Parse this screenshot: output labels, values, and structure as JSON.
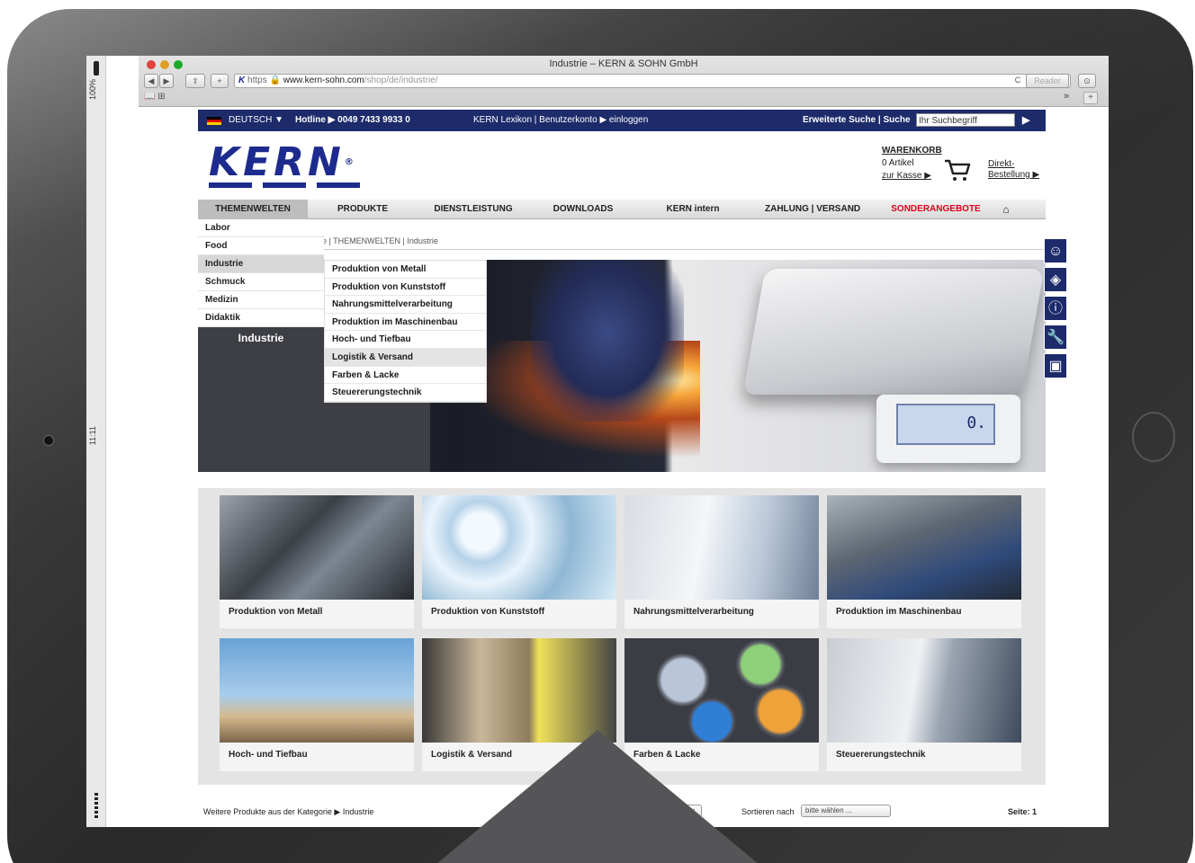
{
  "device": {
    "status_zoom": "100%",
    "status_time": "11:11"
  },
  "browser": {
    "window_title": "Industrie – KERN & SOHN GmbH",
    "url_scheme": "https",
    "url_host": "www.kern-sohn.com",
    "url_path": "/shop/de/industrie/",
    "reader_label": "Reader",
    "back_glyph": "◀",
    "forward_glyph": "▶",
    "share_glyph": "⇪",
    "add_glyph": "+",
    "kern_glyph": "K",
    "bookmark_glyph": "📖 ⊞",
    "more_glyph": "»",
    "newtab_glyph": "+",
    "reload_glyph": "C",
    "download_glyph": "⊙"
  },
  "topbar": {
    "language": "DEUTSCH ▼",
    "hotline": "Hotline ▶ 0049 7433 9933 0",
    "links": "KERN Lexikon | Benutzerkonto ▶ einloggen",
    "search_label": "Erweiterte Suche | Suche",
    "search_placeholder": "Ihr Suchbegriff",
    "search_go": "▶"
  },
  "header": {
    "logo": "KERN",
    "logo_mark": "®",
    "cart_title": "WARENKORB",
    "cart_count": "0 Artikel",
    "cart_checkout": "zur Kasse ▶",
    "direct_order_line1": "Direkt-",
    "direct_order_line2": "Bestellung ▶"
  },
  "mainnav": [
    {
      "label": "THEMENWELTEN"
    },
    {
      "label": "PRODUKTE"
    },
    {
      "label": "DIENSTLEISTUNG"
    },
    {
      "label": "DOWNLOADS"
    },
    {
      "label": "KERN intern"
    },
    {
      "label": "ZAHLUNG | VERSAND"
    },
    {
      "label": "SONDERANGEBOTE"
    },
    {
      "label": "⌂"
    }
  ],
  "breadcrumb": "e | THEMENWELTEN | Industrie",
  "submenu_level1": [
    "Labor",
    "Food",
    "Industrie",
    "Schmuck",
    "Medizin",
    "Didaktik"
  ],
  "submenu_level1_active": "Industrie",
  "submenu_level1_footer": "Industrie",
  "submenu_level2": [
    "Produktion von Metall",
    "Produktion von Kunststoff",
    "Nahrungsmittelverarbeitung",
    "Produktion im Maschinenbau",
    "Hoch- und Tiefbau",
    "Logistik & Versand",
    "Farben & Lacke",
    "Steuererungstechnik"
  ],
  "hero": {
    "display_value": "0."
  },
  "sidetools": [
    {
      "icon": "user-headset-icon",
      "glyph": "☺"
    },
    {
      "icon": "cloud-icon",
      "glyph": "◈"
    },
    {
      "icon": "info-icon",
      "glyph": "ⓘ"
    },
    {
      "icon": "wrench-icon",
      "glyph": "🔧"
    },
    {
      "icon": "book-icon",
      "glyph": "▣"
    }
  ],
  "tiles": [
    {
      "label": "Produktion von Metall"
    },
    {
      "label": "Produktion von Kunststoff"
    },
    {
      "label": "Nahrungsmittelverarbeitung"
    },
    {
      "label": "Produktion im Maschinenbau"
    },
    {
      "label": "Hoch- und Tiefbau"
    },
    {
      "label": "Logistik & Versand"
    },
    {
      "label": "Farben & Lacke"
    },
    {
      "label": "Steuererungstechnik"
    }
  ],
  "footer": {
    "more_products": "Weitere Produkte aus der Kategorie ▶ Industrie",
    "left_select_arrow": "↕",
    "sort_label": "Sortieren nach",
    "sort_select": "bitte wählen ...",
    "page_label": "Seite: 1"
  },
  "colors": {
    "brand_blue": "#1d2b6b",
    "sale_red": "#e0001b"
  }
}
